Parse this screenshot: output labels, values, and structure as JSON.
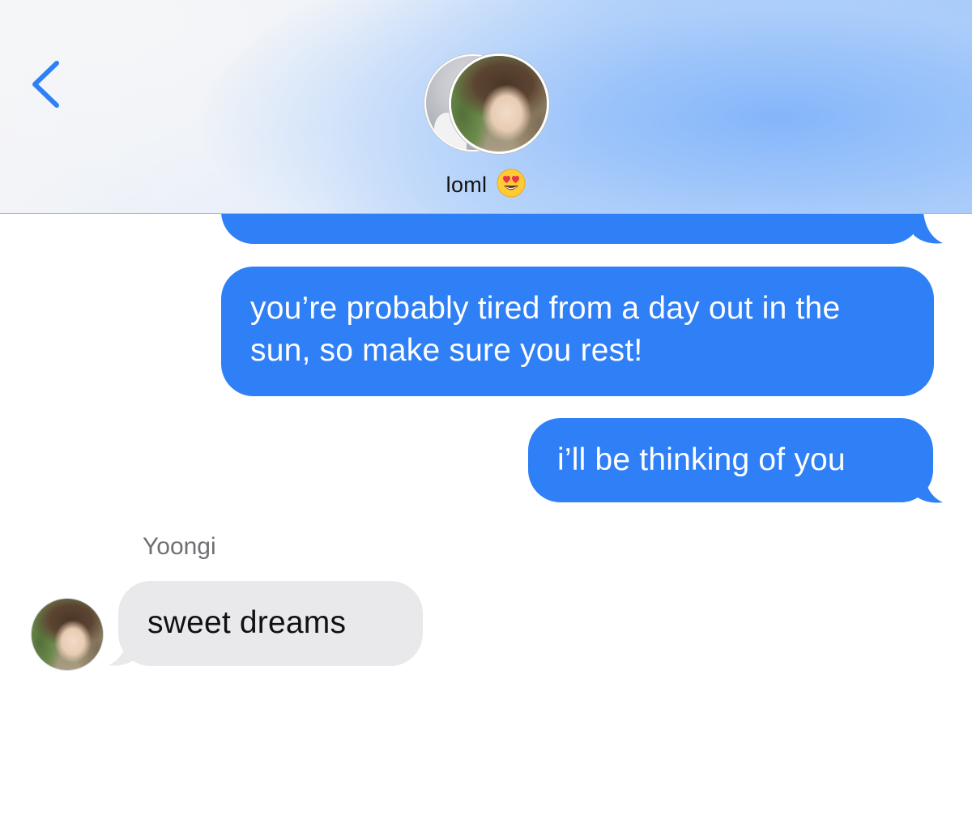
{
  "header": {
    "contact_name": "loml",
    "contact_emoji": "smiling-face-with-heart-eyes",
    "back_icon": "chevron-left-icon",
    "accent_color": "#2f7ff6"
  },
  "messages": [
    {
      "direction": "sent",
      "text": "you’re probably tired from a day out in the sun, so make sure you rest!"
    },
    {
      "direction": "sent",
      "text": "i’ll be thinking of you"
    },
    {
      "direction": "received",
      "sender": "Yoongi",
      "text": "sweet dreams"
    }
  ],
  "colors": {
    "sent_bubble": "#2f7ff6",
    "received_bubble": "#e9e9ec",
    "sender_name": "#6f6f74"
  }
}
